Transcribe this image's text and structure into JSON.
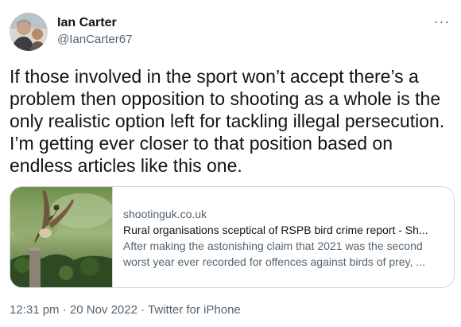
{
  "author": {
    "display_name": "Ian Carter",
    "handle": "@IanCarter67"
  },
  "more_label": "···",
  "tweet": {
    "text": "If those involved in the sport won’t accept there’s a\nproblem then opposition to shooting as a whole is the\nonly realistic option left for tackling illegal persecution.\nI’m getting ever closer to that position based on\nendless articles like this one."
  },
  "card": {
    "domain": "shootinguk.co.uk",
    "title": "Rural organisations sceptical of RSPB bird crime report - Sh...",
    "description_line1": "After making the astonishing claim that 2021 was the second",
    "description_line2": "worst year ever recorded for offences against birds of prey, ..."
  },
  "footer": {
    "time": "12:31 pm",
    "sep1": " · ",
    "date": "20 Nov 2022",
    "sep2": " · ",
    "source": "Twitter for iPhone"
  },
  "colors": {
    "text": "#0f1419",
    "secondary": "#536471",
    "border": "#cfd9de"
  }
}
